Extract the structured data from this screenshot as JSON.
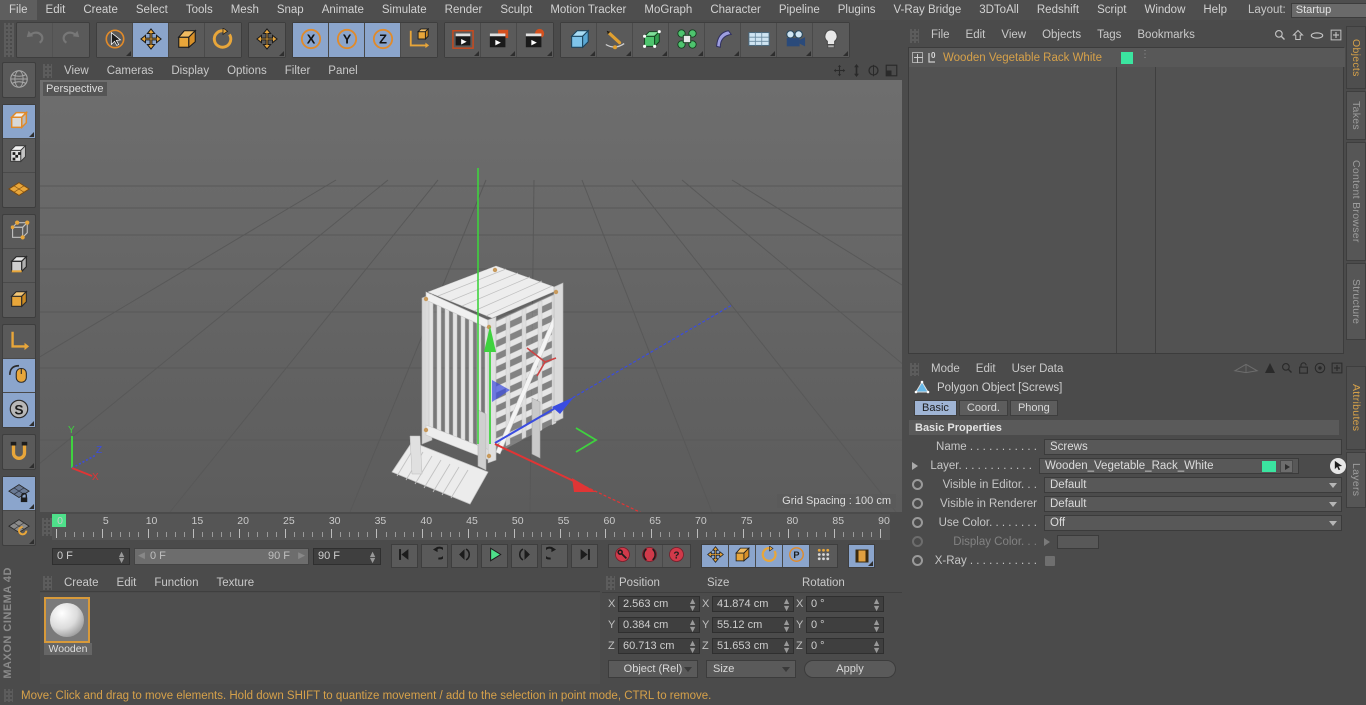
{
  "app": {
    "brand": "MAXON CINEMA 4D"
  },
  "menubar": {
    "items": [
      "File",
      "Edit",
      "Create",
      "Select",
      "Tools",
      "Mesh",
      "Snap",
      "Animate",
      "Simulate",
      "Render",
      "Sculpt",
      "Motion Tracker",
      "MoGraph",
      "Character",
      "Pipeline",
      "Plugins",
      "V-Ray Bridge",
      "3DToAll",
      "Redshift",
      "Script",
      "Window",
      "Help"
    ],
    "layout_label": "Layout:",
    "layout_value": "Startup",
    "search_icon": "search-icon"
  },
  "toolbar": {
    "groups": [
      {
        "name": "undo-redo",
        "buttons": [
          {
            "name": "undo-button",
            "icon": "undo-arrow-icon",
            "state": "disabled"
          },
          {
            "name": "redo-button",
            "icon": "redo-arrow-icon",
            "state": "disabled"
          }
        ]
      },
      {
        "name": "transform-tools",
        "buttons": [
          {
            "name": "live-selection-tool",
            "icon": "cursor-circle-icon",
            "state": "normal"
          },
          {
            "name": "move-tool",
            "icon": "move-cross-icon",
            "state": "active"
          },
          {
            "name": "scale-tool",
            "icon": "scale-box-icon",
            "state": "normal"
          },
          {
            "name": "rotate-tool",
            "icon": "rotate-arc-icon",
            "state": "normal"
          }
        ]
      },
      {
        "name": "move-duplicate",
        "buttons": [
          {
            "name": "move-axis-tool",
            "icon": "move-cross-icon",
            "state": "normal"
          }
        ]
      },
      {
        "name": "axis-locks",
        "buttons": [
          {
            "name": "lock-x-axis",
            "icon": "x-axis-icon",
            "label": "X",
            "state": "active"
          },
          {
            "name": "lock-y-axis",
            "icon": "y-axis-icon",
            "label": "Y",
            "state": "active"
          },
          {
            "name": "lock-z-axis",
            "icon": "z-axis-icon",
            "label": "Z",
            "state": "active"
          },
          {
            "name": "world-object-coords",
            "icon": "world-axis-cube-icon",
            "state": "normal"
          }
        ]
      },
      {
        "name": "render-group",
        "buttons": [
          {
            "name": "render-view-button",
            "icon": "clapper-frame-icon",
            "state": "normal"
          },
          {
            "name": "render-to-picture-viewer-button",
            "icon": "clapper-picture-icon",
            "state": "normal"
          },
          {
            "name": "render-settings-button",
            "icon": "clapper-gear-icon",
            "state": "normal"
          }
        ]
      },
      {
        "name": "create-group",
        "buttons": [
          {
            "name": "add-cube-button",
            "icon": "blue-cube-icon",
            "state": "normal"
          },
          {
            "name": "add-spline-button",
            "icon": "pen-spline-icon",
            "state": "normal"
          },
          {
            "name": "add-nurbs-button",
            "icon": "green-cube-points-icon",
            "state": "normal"
          },
          {
            "name": "add-array-button",
            "icon": "green-cluster-icon",
            "state": "normal"
          },
          {
            "name": "add-deformer-button",
            "icon": "bend-deformer-icon",
            "state": "normal"
          },
          {
            "name": "add-floor-button",
            "icon": "grid-floor-icon",
            "state": "normal"
          },
          {
            "name": "add-camera-button",
            "icon": "camera-icon",
            "state": "normal"
          },
          {
            "name": "add-light-button",
            "icon": "lightbulb-icon",
            "state": "normal"
          }
        ]
      }
    ]
  },
  "left_toolbar": {
    "groups": [
      {
        "buttons": [
          {
            "name": "make-editable-button",
            "icon": "globe-wire-icon",
            "state": "normal"
          }
        ]
      },
      {
        "buttons": [
          {
            "name": "model-mode-button",
            "icon": "model-cube-icon",
            "state": "active"
          },
          {
            "name": "texture-mode-button",
            "icon": "texture-checker-cube-icon",
            "state": "normal"
          },
          {
            "name": "workplane-mode-button",
            "icon": "orange-grid-plane-icon",
            "state": "normal"
          }
        ]
      },
      {
        "buttons": [
          {
            "name": "points-mode-button",
            "icon": "points-cube-icon",
            "state": "normal"
          },
          {
            "name": "edges-mode-button",
            "icon": "edges-cube-icon",
            "state": "normal"
          },
          {
            "name": "polygons-mode-button",
            "icon": "polygons-cube-icon",
            "state": "normal"
          }
        ]
      },
      {
        "buttons": [
          {
            "name": "object-axis-button",
            "icon": "axis-l-icon",
            "state": "normal"
          },
          {
            "name": "viewport-solo-button",
            "icon": "mouse-icon",
            "state": "active"
          },
          {
            "name": "snap-s-button",
            "icon": "s-compass-icon",
            "state": "active"
          }
        ]
      },
      {
        "buttons": [
          {
            "name": "enable-snap-button",
            "icon": "magnet-icon",
            "state": "normal"
          }
        ]
      },
      {
        "buttons": [
          {
            "name": "workplane-lock-button",
            "icon": "grid-lock-icon",
            "state": "active"
          },
          {
            "name": "workplane-rotate-button",
            "icon": "grid-rotate-icon",
            "state": "normal"
          }
        ]
      }
    ]
  },
  "viewport": {
    "menu": [
      "View",
      "Cameras",
      "Display",
      "Options",
      "Filter",
      "Panel"
    ],
    "nav_icons": [
      "pan-icon",
      "dolly-icon",
      "rotate-icon",
      "maximize-icon"
    ],
    "label": "Perspective",
    "grid_spacing": "Grid Spacing : 100 cm",
    "axis_labels": {
      "x": "X",
      "y": "Y",
      "z": "Z"
    },
    "scene_description": "White wooden vegetable rack 3D model with move gizmo",
    "colors": {
      "x_axis": "#e03535",
      "y_axis": "#3fd23f",
      "z_axis": "#3a4ce0",
      "background": "#636363"
    }
  },
  "timeline": {
    "ticks": [
      "0",
      "5",
      "10",
      "15",
      "20",
      "25",
      "30",
      "35",
      "40",
      "45",
      "50",
      "55",
      "60",
      "65",
      "70",
      "75",
      "80",
      "85",
      "90"
    ],
    "current_frame_field": "0 F",
    "current_frame_field2": "0 F",
    "preview_min": "0 F",
    "preview_max": "90 F",
    "max_frame_field": "90 F",
    "transport_buttons": [
      {
        "name": "go-to-start-button",
        "icon": "skip-start-icon"
      },
      {
        "name": "go-to-previous-key-button",
        "icon": "prev-key-icon"
      },
      {
        "name": "step-back-button",
        "icon": "step-back-icon"
      },
      {
        "name": "play-button",
        "icon": "play-icon"
      },
      {
        "name": "step-forward-button",
        "icon": "step-forward-icon"
      },
      {
        "name": "go-to-next-key-button",
        "icon": "next-key-icon"
      },
      {
        "name": "go-to-end-button",
        "icon": "skip-end-icon"
      }
    ],
    "key_buttons": [
      {
        "name": "record-keyframe-button",
        "icon": "red-key-icon"
      },
      {
        "name": "autokeying-button",
        "icon": "red-autokey-icon"
      },
      {
        "name": "keyframe-selection-button",
        "icon": "red-question-icon"
      }
    ],
    "key_filters": [
      {
        "name": "position-key-toggle",
        "icon": "move-cross-icon",
        "state": "active"
      },
      {
        "name": "scale-key-toggle",
        "icon": "scale-box-icon",
        "state": "active"
      },
      {
        "name": "rotation-key-toggle",
        "icon": "rotate-arc-icon",
        "state": "active"
      },
      {
        "name": "parameter-key-toggle",
        "icon": "p-circle-icon",
        "state": "active"
      },
      {
        "name": "point-level-animation-toggle",
        "icon": "dots-grid-icon",
        "state": "normal"
      }
    ],
    "extra_button": {
      "name": "timeline-filmstrip-button",
      "icon": "filmstrip-icon",
      "state": "active"
    }
  },
  "material_manager": {
    "menu": [
      "Create",
      "Edit",
      "Function",
      "Texture"
    ],
    "materials": [
      {
        "name": "Wooden",
        "label": "Wooden",
        "thumb": "sphere-preview"
      }
    ]
  },
  "coordinates": {
    "headers": [
      "Position",
      "Size",
      "Rotation"
    ],
    "rows": [
      {
        "axis": "X",
        "position": "2.563 cm",
        "size": "41.874 cm",
        "rotation": "0 °"
      },
      {
        "axis": "Y",
        "position": "0.384 cm",
        "size": "55.12 cm",
        "rotation": "0 °"
      },
      {
        "axis": "Z",
        "position": "60.713 cm",
        "size": "51.653 cm",
        "rotation": "0 °"
      }
    ],
    "mode_value": "Object (Rel)",
    "size_value": "Size",
    "apply_label": "Apply"
  },
  "object_manager": {
    "menu": [
      "File",
      "Edit",
      "View",
      "Objects",
      "Tags",
      "Bookmarks"
    ],
    "icons": [
      "search-icon",
      "home-icon",
      "ellipse-icon",
      "plus-box-icon"
    ],
    "objects": [
      {
        "name": "Wooden Vegetable Rack White",
        "layer_color": "#3be5a0",
        "level_badge": "0",
        "selected": true
      }
    ]
  },
  "attribute_manager": {
    "menu": [
      "Mode",
      "Edit",
      "User Data"
    ],
    "icons": [
      "plane-icon",
      "arrow-up-icon",
      "search-icon",
      "lock-icon",
      "target-icon",
      "plus-box-icon"
    ],
    "object_type": "Polygon Object [Screws]",
    "tabs": [
      {
        "label": "Basic",
        "active": true
      },
      {
        "label": "Coord.",
        "active": false
      },
      {
        "label": "Phong",
        "active": false
      }
    ],
    "section_title": "Basic Properties",
    "fields": [
      {
        "label": "Name . . . . . . . . . . .",
        "value": "Screws",
        "type": "text",
        "name": "name-field"
      },
      {
        "label": "Layer. . . . . . . . . . . .",
        "value": "Wooden_Vegetable_Rack_White",
        "type": "layer",
        "swatch": "#3be5a0",
        "name": "layer-field"
      },
      {
        "label": "Visible in Editor. . .",
        "value": "Default",
        "type": "dropdown",
        "name": "visible-in-editor-dropdown"
      },
      {
        "label": "Visible in Renderer",
        "value": "Default",
        "type": "dropdown",
        "name": "visible-in-renderer-dropdown"
      },
      {
        "label": "Use Color. . . . . . . .",
        "value": "Off",
        "type": "dropdown",
        "name": "use-color-dropdown"
      },
      {
        "label": "Display Color. . .",
        "value": "",
        "type": "color",
        "name": "display-color-swatch",
        "disabled": true
      },
      {
        "label": "X-Ray . . . . . . . . . . .",
        "value": "",
        "type": "checkbox",
        "name": "x-ray-checkbox"
      }
    ]
  },
  "right_tabs": {
    "top": [
      {
        "label": "Objects",
        "active": true
      },
      {
        "label": "Takes",
        "active": false
      },
      {
        "label": "Content Browser",
        "active": false
      },
      {
        "label": "Structure",
        "active": false
      }
    ],
    "bottom": [
      {
        "label": "Attributes",
        "active": true
      },
      {
        "label": "Layers",
        "active": false
      }
    ]
  },
  "statusbar": {
    "text": "Move: Click and drag to move elements. Hold down SHIFT to quantize movement / add to the selection in point mode, CTRL to remove."
  }
}
